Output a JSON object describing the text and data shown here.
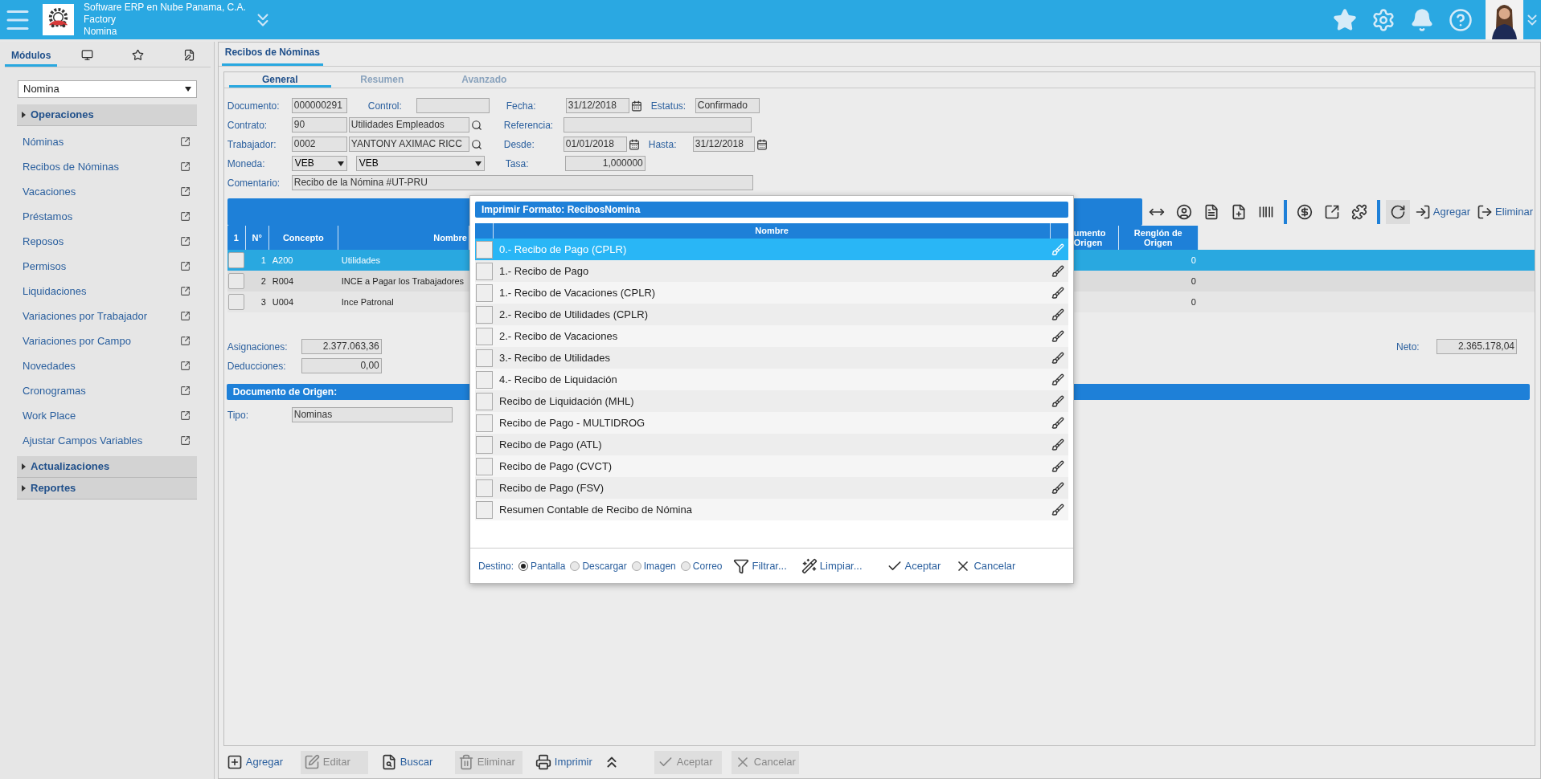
{
  "header": {
    "company": "Software ERP en Nube Panama, C.A.",
    "branch": "Factory",
    "module": "Nomina"
  },
  "sidebar": {
    "tabs": [
      {
        "kind": "text",
        "label": "Módulos",
        "selected": true
      },
      {
        "kind": "monitor",
        "selected": false
      },
      {
        "kind": "star",
        "selected": false
      },
      {
        "kind": "pen",
        "selected": false
      }
    ],
    "module_select": "Nomina",
    "sections": [
      {
        "label": "Operaciones",
        "items": [
          "Nóminas",
          "Recibos de Nóminas",
          "Vacaciones",
          "Préstamos",
          "Reposos",
          "Permisos",
          "Liquidaciones",
          "Variaciones por Trabajador",
          "Variaciones por Campo",
          "Novedades",
          "Cronogramas",
          "Work Place",
          "Ajustar Campos Variables"
        ]
      },
      {
        "label": "Actualizaciones"
      },
      {
        "label": "Reportes"
      }
    ]
  },
  "page_tab": "Recibos de Nóminas",
  "form_tabs": [
    {
      "label": "General",
      "selected": true
    },
    {
      "label": "Resumen",
      "selected": false
    },
    {
      "label": "Avanzado",
      "selected": false
    }
  ],
  "form": {
    "documento": {
      "label": "Documento:",
      "value": "000000291"
    },
    "control": {
      "label": "Control:"
    },
    "fecha": {
      "label": "Fecha:",
      "value": "31/12/2018"
    },
    "estatus": {
      "label": "Estatus:",
      "value": "Confirmado"
    },
    "contrato": {
      "label": "Contrato:",
      "code": "90",
      "name": "Utilidades Empleados"
    },
    "referencia": {
      "label": "Referencia:"
    },
    "trabajador": {
      "label": "Trabajador:",
      "code": "0002",
      "name": "YANTONY AXIMAC RICC"
    },
    "desde": {
      "label": "Desde:",
      "value": "01/01/2018"
    },
    "hasta": {
      "label": "Hasta:",
      "value": "31/12/2018"
    },
    "moneda": {
      "label": "Moneda:",
      "code": "VEB",
      "name": "VEB"
    },
    "tasa": {
      "label": "Tasa:",
      "value": "1,000000"
    },
    "comentario": {
      "label": "Comentario:",
      "value": "Recibo de la Nómina #UT-PRU"
    }
  },
  "grid_toolbar": [
    {
      "kind": "resize",
      "pressed": false
    },
    {
      "kind": "user",
      "pressed": false
    },
    {
      "kind": "document",
      "pressed": false
    },
    {
      "kind": "document-plus",
      "pressed": false
    },
    {
      "kind": "barcode",
      "pressed": false
    },
    {
      "kind": "separator"
    },
    {
      "kind": "dollar",
      "pressed": false
    },
    {
      "kind": "external",
      "pressed": false
    },
    {
      "kind": "puzzle",
      "pressed": false
    },
    {
      "kind": "separator"
    },
    {
      "kind": "refresh",
      "pressed": true
    },
    {
      "kind": "import",
      "label": "Agregar",
      "pressed": false
    },
    {
      "kind": "export",
      "label": "Eliminar",
      "pressed": false
    }
  ],
  "table": {
    "columns": [
      "1",
      "N°",
      "Concepto",
      "Nombre",
      "umento Origen",
      "Renglón de Origen"
    ],
    "rows": [
      {
        "n": "1",
        "concepto": "A200",
        "nombre": "Utilidades",
        "renglon": "0",
        "selected": true
      },
      {
        "n": "2",
        "concepto": "R004",
        "nombre": "INCE a Pagar los Trabajadores",
        "renglon": "0",
        "selected": false
      },
      {
        "n": "3",
        "concepto": "U004",
        "nombre": "Ince Patronal",
        "renglon": "0",
        "selected": false
      }
    ]
  },
  "totals": {
    "asignaciones": {
      "label": "Asignaciones:",
      "value": "2.377.063,36"
    },
    "deducciones": {
      "label": "Deducciones:",
      "value": "0,00"
    },
    "neto": {
      "label": "Neto:",
      "value": "2.365.178,04"
    }
  },
  "origen": {
    "title": "Documento de Origen:",
    "tipo": {
      "label": "Tipo:",
      "value": "Nominas"
    }
  },
  "bottom_buttons": [
    {
      "kind": "add",
      "label": "Agregar",
      "disabled": false
    },
    {
      "kind": "edit",
      "label": "Editar",
      "disabled": true
    },
    {
      "kind": "search",
      "label": "Buscar",
      "disabled": false
    },
    {
      "kind": "delete",
      "label": "Eliminar",
      "disabled": true
    },
    {
      "kind": "print",
      "label": "Imprimir",
      "disabled": false
    },
    {
      "kind": "more"
    },
    {
      "kind": "accept",
      "label": "Aceptar",
      "disabled": true
    },
    {
      "kind": "cancel",
      "label": "Cancelar",
      "disabled": true
    }
  ],
  "dialog": {
    "title": "Imprimir Formato: RecibosNomina",
    "column": "Nombre",
    "rows": [
      {
        "name": "0.- Recibo de Pago (CPLR)",
        "selected": true
      },
      {
        "name": "1.- Recibo de Pago",
        "selected": false
      },
      {
        "name": "1.- Recibo de Vacaciones (CPLR)",
        "selected": false
      },
      {
        "name": "2.- Recibo de Utilidades (CPLR)",
        "selected": false
      },
      {
        "name": "2.- Recibo de Vacaciones",
        "selected": false
      },
      {
        "name": "3.- Recibo de Utilidades",
        "selected": false
      },
      {
        "name": "4.- Recibo de Liquidación",
        "selected": false
      },
      {
        "name": "Recibo de Liquidación (MHL)",
        "selected": false
      },
      {
        "name": "Recibo de Pago - MULTIDROG",
        "selected": false
      },
      {
        "name": "Recibo de Pago (ATL)",
        "selected": false
      },
      {
        "name": "Recibo de Pago (CVCT)",
        "selected": false
      },
      {
        "name": "Recibo de Pago (FSV)",
        "selected": false
      },
      {
        "name": "Resumen Contable de Recibo de Nómina",
        "selected": false
      }
    ],
    "destino_label": "Destino:",
    "destinos": [
      {
        "label": "Pantalla",
        "selected": true
      },
      {
        "label": "Descargar",
        "selected": false
      },
      {
        "label": "Imagen",
        "selected": false
      },
      {
        "label": "Correo",
        "selected": false
      }
    ],
    "actions": [
      {
        "kind": "filter",
        "label": "Filtrar..."
      },
      {
        "kind": "clear",
        "label": "Limpiar..."
      },
      {
        "kind": "accept",
        "label": "Aceptar"
      },
      {
        "kind": "cancel",
        "label": "Cancelar"
      }
    ]
  }
}
